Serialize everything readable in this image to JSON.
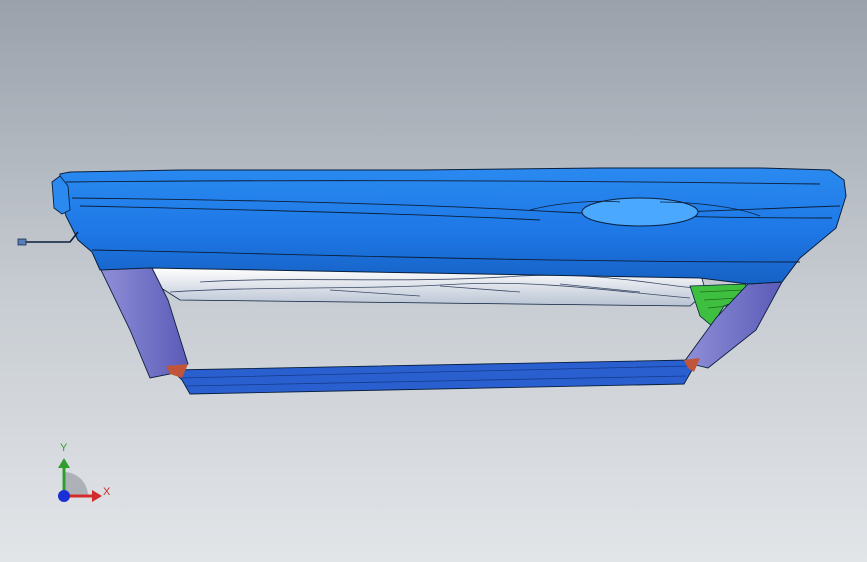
{
  "view": {
    "background_top": "#9aa1ab",
    "background_bottom": "#e2e5e8"
  },
  "model": {
    "part": "door-panel",
    "colors": {
      "outer_panel": "#1e78e6",
      "outer_panel_shade": "#1661c4",
      "edge_lines": "#0a1f3c",
      "pillars": "#6f6fc4",
      "sill": "#2a5fd0",
      "inner_panel": "#c9d1de",
      "bracket": "#3fbf3f",
      "corner_accent": "#c0553a"
    }
  },
  "triad": {
    "x_axis_label": "X",
    "y_axis_label": "Y",
    "x_color": "#d22b2b",
    "y_color": "#2f9e2f",
    "z_color": "#1a2fd6"
  }
}
